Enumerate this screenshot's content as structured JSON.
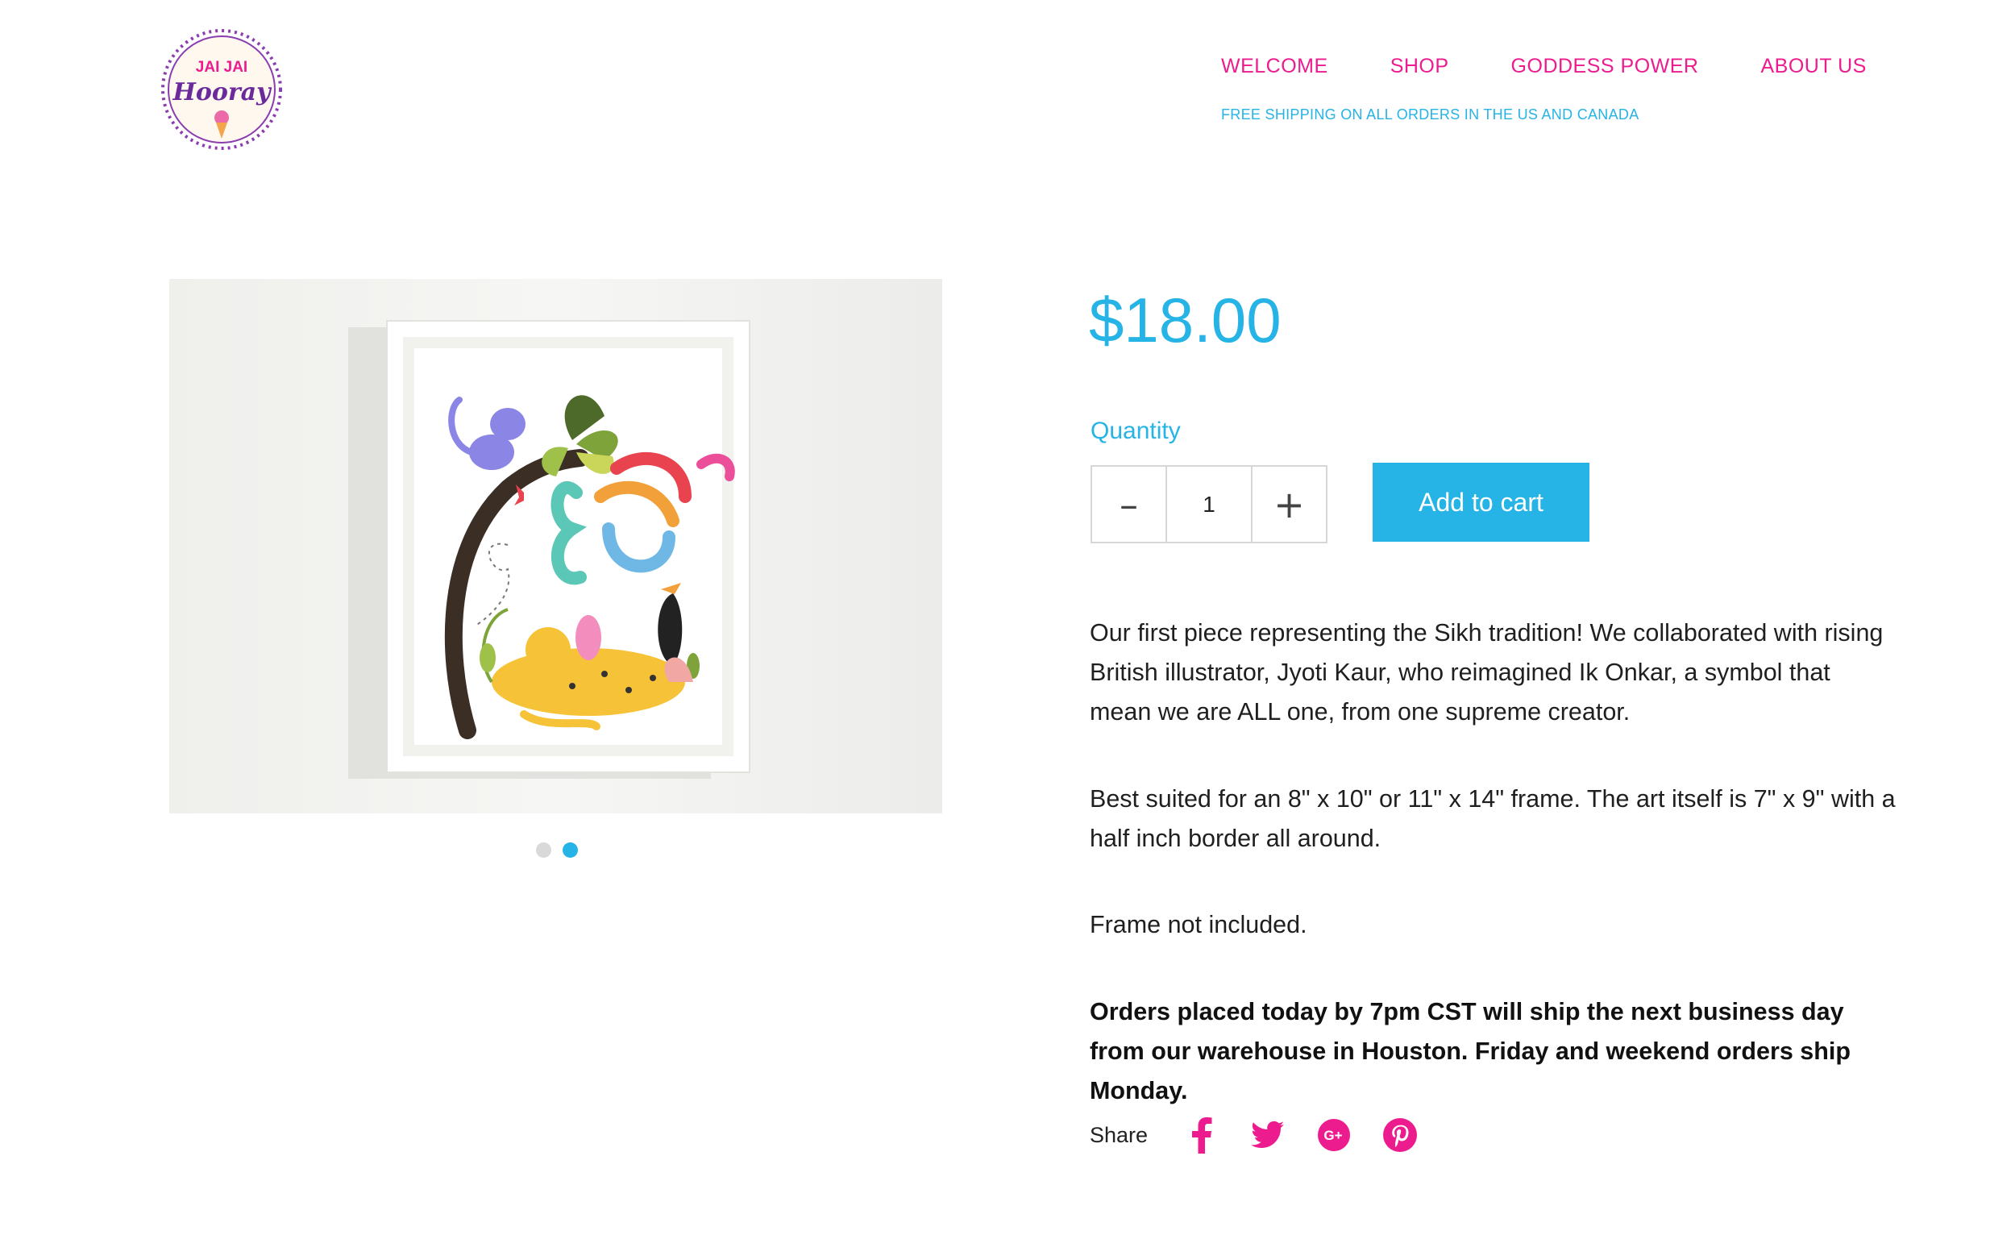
{
  "brand": {
    "logo_text_top": "JAI JAI",
    "logo_text_bottom": "Hooray",
    "colors": {
      "pink": "#ec1c8f",
      "blue": "#26b3e6",
      "purple": "#8b3db0"
    }
  },
  "nav": {
    "items": [
      {
        "label": "WELCOME"
      },
      {
        "label": "SHOP"
      },
      {
        "label": "GODDESS POWER"
      },
      {
        "label": "ABOUT US"
      }
    ],
    "promo": "FREE SHIPPING ON ALL ORDERS IN THE US AND CANADA"
  },
  "product": {
    "price": "$18.00",
    "quantity_label": "Quantity",
    "quantity_value": "1",
    "minus_symbol": "–",
    "plus_symbol": "+",
    "add_to_cart": "Add to cart",
    "gallery_dots": 2,
    "active_dot": 2,
    "description": [
      "Our first piece representing the Sikh tradition! We collaborated with rising British illustrator, Jyoti Kaur, who reimagined Ik Onkar, a symbol that mean we are ALL one, from one supreme creator.",
      "Best suited for an 8\" x 10\" or 11\" x 14\" frame. The art itself is 7\" x 9\" with a half inch border all around.",
      "Frame not included.",
      "Orders placed today by 7pm CST will ship the next business day from our warehouse in Houston. Friday and weekend orders ship Monday."
    ]
  },
  "share": {
    "label": "Share",
    "icons": [
      "facebook-icon",
      "twitter-icon",
      "google-plus-icon",
      "pinterest-icon"
    ]
  }
}
